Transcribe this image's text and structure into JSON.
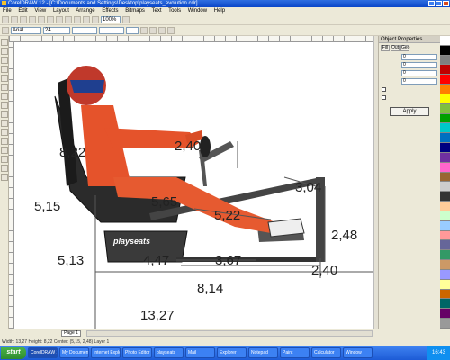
{
  "window": {
    "title": "CorelDRAW 12 - [C:\\Documents and Settings\\Desktop\\playseats_evolution.cdr]"
  },
  "menubar": {
    "items": [
      "File",
      "Edit",
      "View",
      "Layout",
      "Arrange",
      "Effects",
      "Bitmaps",
      "Text",
      "Tools",
      "Window",
      "Help"
    ]
  },
  "toolbar": {
    "zoom_value": "100%"
  },
  "property_bar": {
    "font_name": "Arial",
    "font_size": "24"
  },
  "canvas": {
    "product_logo": "playseats",
    "dimensions": [
      "8,22",
      "2,40",
      "5,15",
      "5,65",
      "3,04",
      "2,48",
      "5,22",
      "5,13",
      "4,47",
      "3,67",
      "2,40",
      "8,14",
      "13,27"
    ]
  },
  "docker": {
    "title": "Object Properties",
    "tab_labels": [
      "Fill",
      "Out",
      "Geo"
    ],
    "field_values": [
      "0",
      "0",
      "0",
      "0"
    ],
    "apply_label": "Apply"
  },
  "status_bar": {
    "page_tab": "Page 1",
    "info": "Width: 13,27  Height: 8,22  Center: (5,15, 2,48)  Layer 1"
  },
  "taskbar": {
    "start_label": "start",
    "tasks": [
      "CorelDRAW 12",
      "My Documents",
      "Internet Explorer",
      "Photo Editor",
      "playseats",
      "Mail",
      "Explorer",
      "Notepad",
      "Paint",
      "Calculator",
      "Window"
    ],
    "clock": "16:43"
  },
  "palette": {
    "colors": [
      "#ffffff",
      "#000000",
      "#7f7f7f",
      "#c00000",
      "#ff0000",
      "#ff7f00",
      "#ffff00",
      "#7fbf3f",
      "#00a000",
      "#00c8c8",
      "#0070c0",
      "#000080",
      "#7030a0",
      "#ff66cc",
      "#996633",
      "#cccccc",
      "#333333",
      "#ffcc99",
      "#ccffcc",
      "#99ccff",
      "#ff9999",
      "#666699",
      "#339966",
      "#cc9966",
      "#9999ff",
      "#ffff99",
      "#cc6600",
      "#006666",
      "#660066",
      "#999999"
    ]
  }
}
